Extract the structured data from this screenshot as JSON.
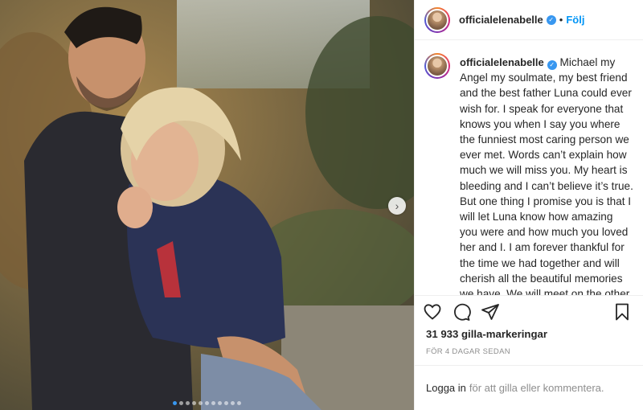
{
  "post": {
    "username": "officialelenabelle",
    "follow_label": "Följ",
    "caption": "Michael my Angel my soulmate, my best friend and the best father Luna could ever wish for. I speak for everyone that knows you when I say you where the funniest most caring person we ever met. Words can’t explain how much we will miss you. My heart is bleeding and I can’t believe it’s true. But one thing I promise you is that I will let Luna know how amazing you were and how much you loved her and I. I am forever thankful for the time we had together and will cherish all the beautiful memories we have. We will meet on the other side one day my love. I Love you with all my heart and soul R.I.P my angel Michael 👨‍👧 👨🏻 👶🏼 🖤 Thank you to all my amazing friends and family that has been by our side during this",
    "likes": "31 933 gilla-markeringar",
    "timestamp": "FÖR 4 DAGAR SEDAN",
    "login_link": "Logga in",
    "login_rest": "för att gilla eller kommentera."
  },
  "carousel": {
    "count": 11,
    "active": 0
  },
  "icons": {
    "verified": "verified-badge-icon",
    "next": "chevron-right-icon",
    "like": "heart-icon",
    "comment": "comment-icon",
    "share": "share-icon",
    "save": "bookmark-icon"
  },
  "colors": {
    "accent": "#0095f6",
    "verified": "#3897f0",
    "muted": "#8e8e8e"
  }
}
